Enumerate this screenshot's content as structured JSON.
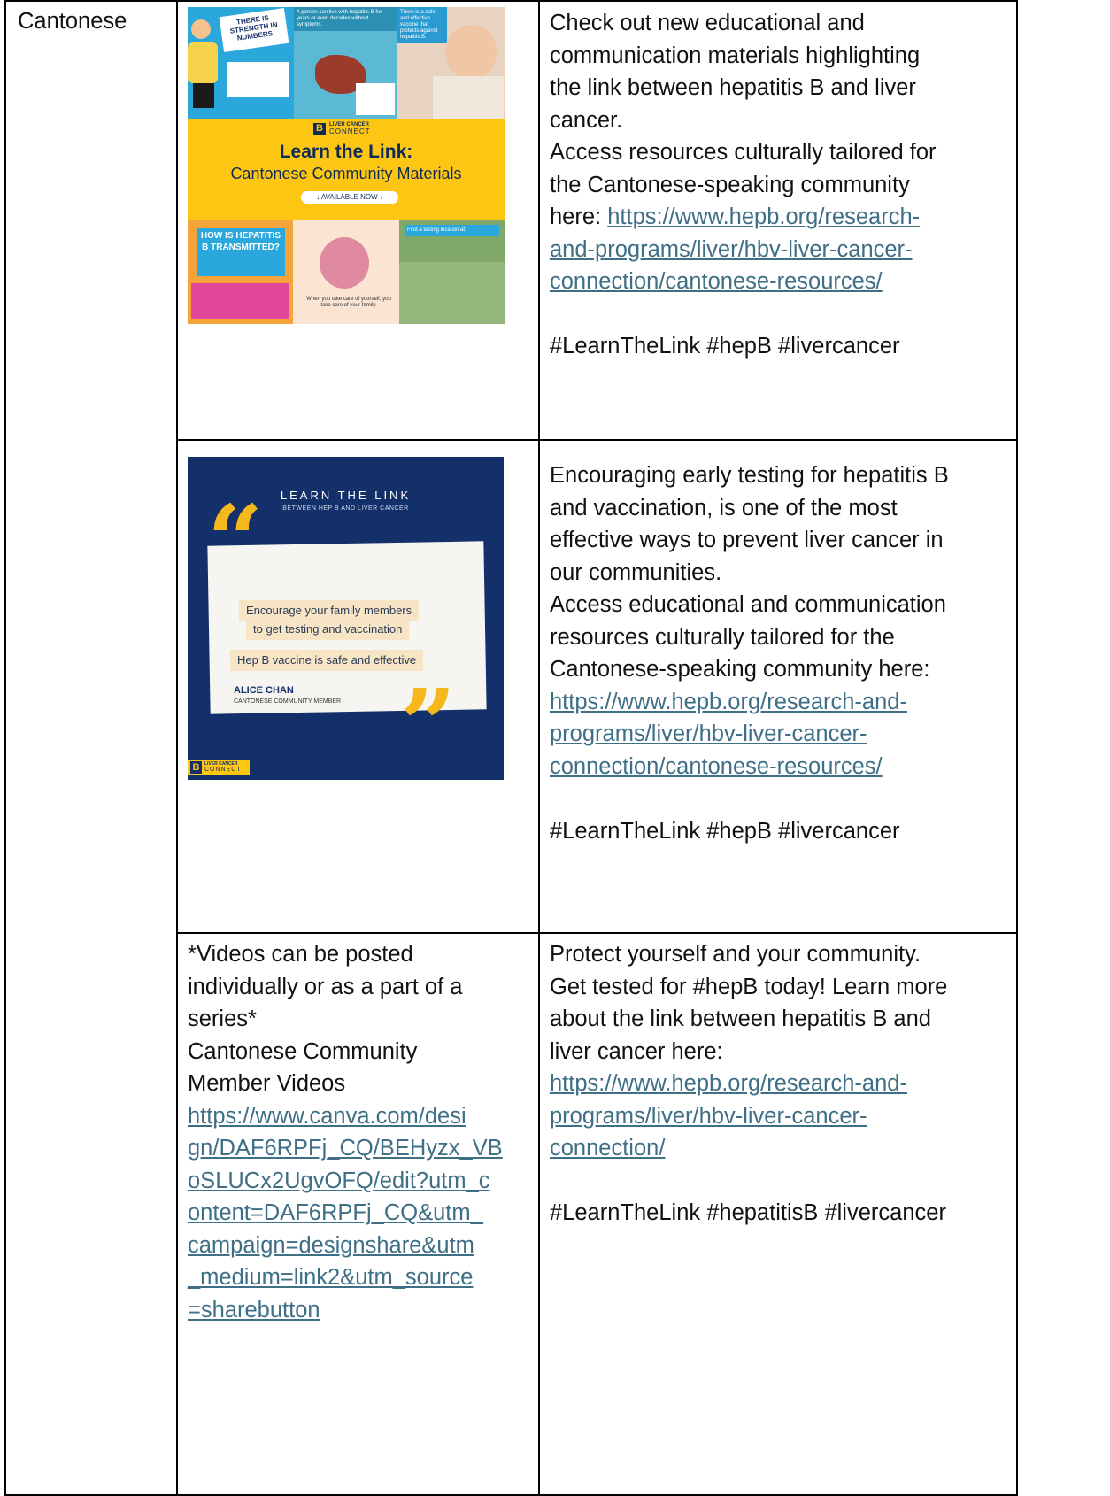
{
  "language": "Cantonese",
  "rows": [
    {
      "poster": {
        "panel1_text": "THERE IS STRENGTH IN NUMBERS",
        "panel2_text": "A person can live with hepatitis B for years or even decades without symptoms.",
        "panel3_text": "There is a safe and effective vaccine that protects against hepatitis B.",
        "brand_line1": "LIVER CANCER",
        "brand_line2": "CONNECT",
        "title": "Learn the Link:",
        "subtitle": "Cantonese Community Materials",
        "available": "↓ AVAILABLE NOW ↓",
        "panel4_title": "HOW IS HEPATITIS B TRANSMITTED?",
        "panel5_text": "When you take care of yourself, you take care of your family.",
        "panel6_text": "Find a testing location at:"
      },
      "lines": [
        "Check out new educational and",
        "communication materials highlighting",
        "the link between hepatitis B and liver",
        "cancer.",
        "Access resources culturally tailored for",
        "the Cantonese-speaking community",
        "here: "
      ],
      "link_lines": [
        "https://www.hepb.org/research-",
        "and-programs/liver/hbv-liver-cancer-",
        "connection/cantonese-resources/"
      ],
      "hashtags": "#LearnTheLink #hepB #livercancer"
    },
    {
      "quote": {
        "heading": "LEARN THE LINK",
        "subheading": "BETWEEN HEP B AND LIVER CANCER",
        "line1": "Encourage your family members",
        "line2": "to get testing and vaccination",
        "line3": "Hep B vaccine is safe and effective",
        "name": "ALICE CHAN",
        "role": "CANTONESE COMMUNITY MEMBER",
        "brand_line1": "LIVER CANCER",
        "brand_line2": "CONNECT"
      },
      "lines": [
        "Encouraging early testing for hepatitis B",
        "and vaccination, is one of the most",
        "effective ways to prevent liver cancer in",
        "our communities.",
        "Access educational and communication",
        "resources culturally tailored for the",
        "Cantonese-speaking community here:"
      ],
      "link_lines": [
        "https://www.hepb.org/research-and-",
        "programs/liver/hbv-liver-cancer-",
        "connection/cantonese-resources/"
      ],
      "hashtags": "#LearnTheLink #hepB #livercancer"
    },
    {
      "left_lines": [
        "*Videos can be posted",
        "individually or as a part of a",
        "series*",
        "Cantonese Community",
        "Member Videos"
      ],
      "left_link_lines": [
        "https://www.canva.com/desi",
        "gn/DAF6RPFj_CQ/BEHyzx_VB",
        "oSLUCx2UgvOFQ/edit?utm_c",
        "ontent=DAF6RPFj_CQ&utm_",
        "campaign=designshare&utm",
        "_medium=link2&utm_source",
        "=sharebutton"
      ],
      "lines": [
        "Protect yourself and your community.",
        "Get tested for #hepB today! Learn more",
        "about the link between hepatitis B and",
        "liver cancer here:"
      ],
      "link_lines": [
        "https://www.hepb.org/research-and-",
        "programs/liver/hbv-liver-cancer-",
        "connection/"
      ],
      "hashtags": "#LearnTheLink #hepatitisB #livercancer"
    }
  ]
}
